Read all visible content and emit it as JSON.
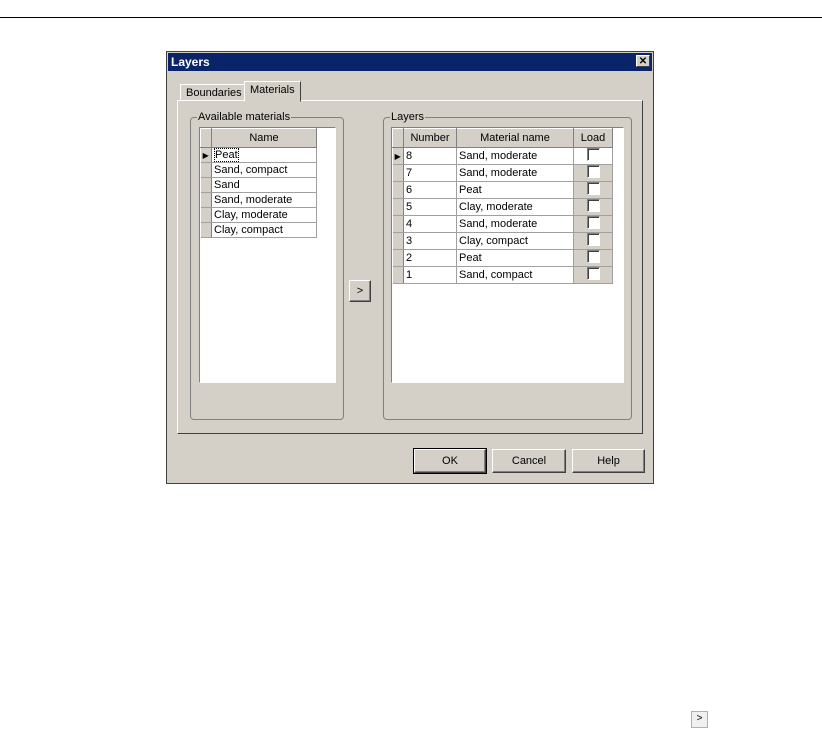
{
  "window": {
    "title": "Layers",
    "close_glyph": "✕"
  },
  "tabs": [
    {
      "label": "Boundaries"
    },
    {
      "label": "Materials"
    }
  ],
  "available": {
    "group_label": "Available materials",
    "column": "Name",
    "current_glyph": "▶",
    "rows": [
      "Peat",
      "Sand, compact",
      "Sand",
      "Sand, moderate",
      "Clay, moderate",
      "Clay, compact"
    ]
  },
  "transfer_button": {
    "label": ">"
  },
  "layers": {
    "group_label": "Layers",
    "columns": {
      "number": "Number",
      "material": "Material name",
      "load": "Load"
    },
    "rows": [
      {
        "number": "8",
        "material": "Sand, moderate",
        "load": false
      },
      {
        "number": "7",
        "material": "Sand, moderate",
        "load": false
      },
      {
        "number": "6",
        "material": "Peat",
        "load": false
      },
      {
        "number": "5",
        "material": "Clay, moderate",
        "load": false
      },
      {
        "number": "4",
        "material": "Sand, moderate",
        "load": false
      },
      {
        "number": "3",
        "material": "Clay, compact",
        "load": false
      },
      {
        "number": "2",
        "material": "Peat",
        "load": false
      },
      {
        "number": "1",
        "material": "Sand, compact",
        "load": false
      }
    ]
  },
  "buttons": {
    "ok": "OK",
    "cancel": "Cancel",
    "help": "Help"
  },
  "page_arrow": {
    "label": ">"
  }
}
